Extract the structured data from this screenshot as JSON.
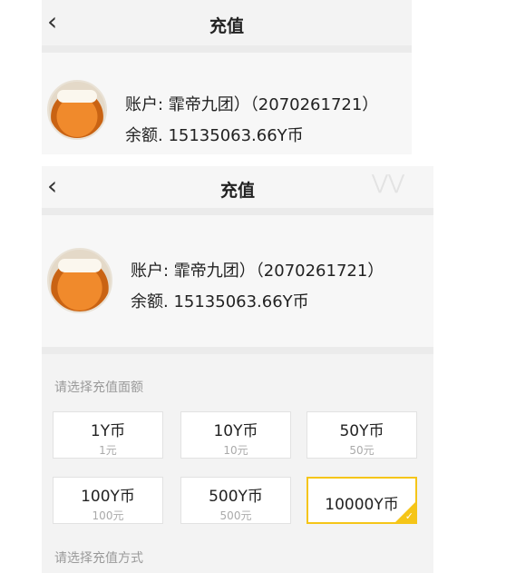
{
  "screen1": {
    "back_icon": "chevron-left-icon",
    "title": "充值",
    "account_label": "账户: 霏帝九团）（2070261721）",
    "balance_label": "余额. 15135063.66Y币"
  },
  "screen2": {
    "back_icon": "chevron-left-icon",
    "title": "充值",
    "account_label": "账户: 霏帝九团）（2070261721）",
    "balance_label": "余额. 15135063.66Y币",
    "select_amount_label": "请选择充值面额",
    "options": [
      {
        "coins": "1Y币",
        "price": "1元",
        "selected": false
      },
      {
        "coins": "10Y币",
        "price": "10元",
        "selected": false
      },
      {
        "coins": "50Y币",
        "price": "50元",
        "selected": false
      },
      {
        "coins": "100Y币",
        "price": "100元",
        "selected": false
      },
      {
        "coins": "500Y币",
        "price": "500元",
        "selected": false
      },
      {
        "coins": "10000Y币",
        "price": "",
        "selected": true
      }
    ],
    "select_method_label": "请选择充值方式"
  },
  "colors": {
    "accent": "#f5c518",
    "header_bg": "#f3f3f3"
  }
}
